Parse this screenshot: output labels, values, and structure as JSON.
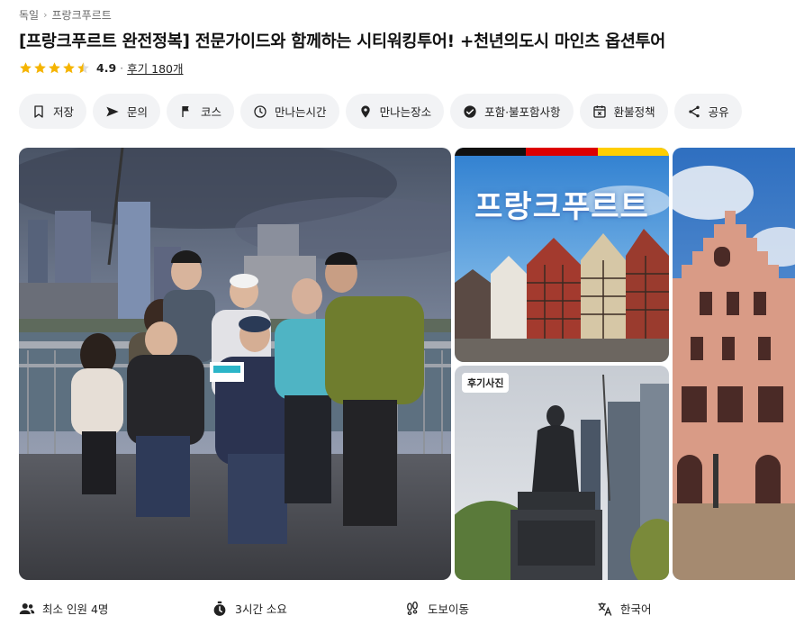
{
  "breadcrumb": {
    "level1": "독일",
    "level2": "프랑크푸르트"
  },
  "title": "[프랑크푸르트 완전정복] 전문가이드와 함께하는  시티워킹투어! +천년의도시 마인츠 옵션투어",
  "rating": {
    "value": "4.9",
    "separator": "·",
    "reviews_label": "후기 180개",
    "stars": 4.5,
    "star_color": "#f5b400"
  },
  "chips": [
    {
      "label": "저장",
      "icon": "bookmark-icon"
    },
    {
      "label": "문의",
      "icon": "send-icon"
    },
    {
      "label": "코스",
      "icon": "flag-icon"
    },
    {
      "label": "만나는시간",
      "icon": "clock-icon"
    },
    {
      "label": "만나는장소",
      "icon": "location-pin-icon"
    },
    {
      "label": "포함·불포함사항",
      "icon": "check-circle-icon"
    },
    {
      "label": "환불정책",
      "icon": "calendar-x-icon"
    },
    {
      "label": "공유",
      "icon": "share-icon"
    }
  ],
  "gallery": {
    "banner_text": "프랑크푸르트",
    "review_photo_badge": "후기사진",
    "flag_colors": [
      "#111111",
      "#dd0000",
      "#ffce00"
    ]
  },
  "info": [
    {
      "label": "최소 인원 4명",
      "icon": "people-icon"
    },
    {
      "label": "3시간 소요",
      "icon": "stopwatch-icon"
    },
    {
      "label": "도보이동",
      "icon": "footprints-icon"
    },
    {
      "label": "한국어",
      "icon": "translate-icon"
    }
  ]
}
